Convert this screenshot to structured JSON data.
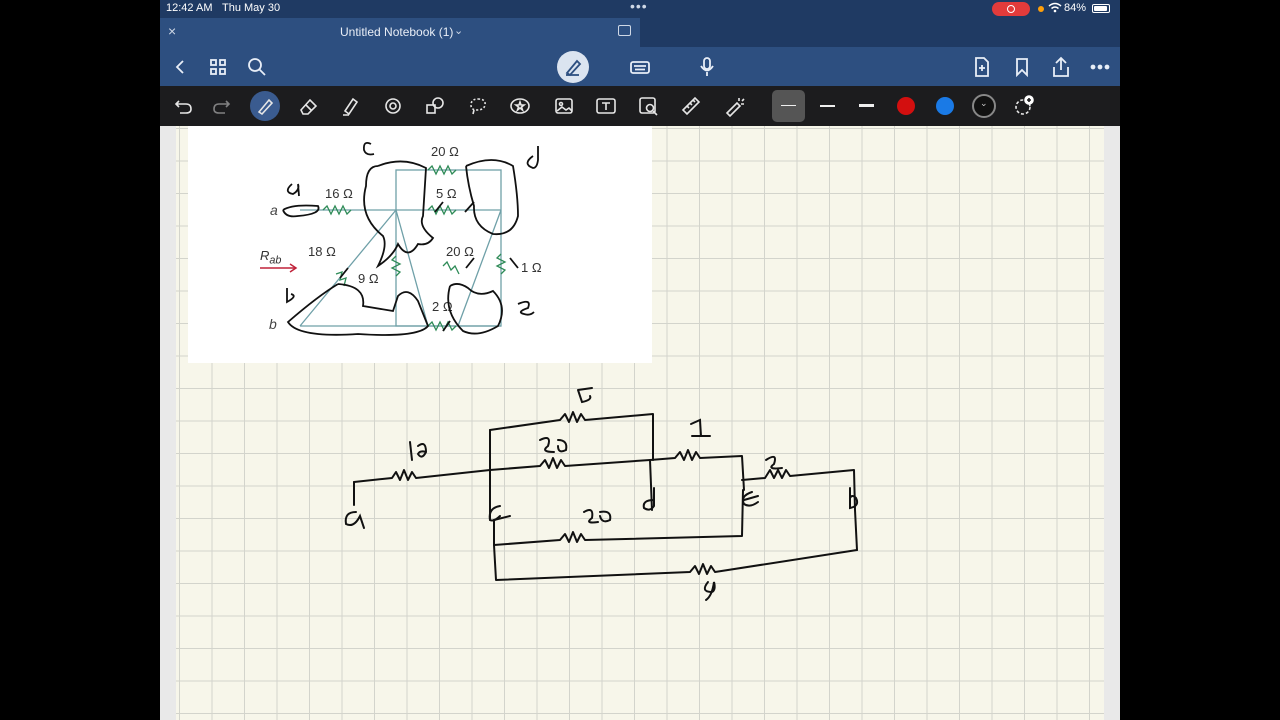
{
  "status": {
    "time": "12:42 AM",
    "date": "Thu May 30",
    "battery": "84%"
  },
  "tab": {
    "title": "Untitled Notebook (1)"
  },
  "toolbar": {
    "colors": [
      "#d30f0f",
      "#1a7ae6"
    ]
  },
  "figure": {
    "resistor_labels": [
      "20 Ω",
      "16 Ω",
      "5 Ω",
      "18 Ω",
      "20 Ω",
      "9 Ω",
      "1 Ω",
      "2 Ω"
    ],
    "nodes": [
      "a",
      "b"
    ],
    "rab_main": "R",
    "rab_sub": "ab",
    "handwritten_nodes": [
      "c",
      "d",
      "a",
      "b",
      "e"
    ]
  },
  "notes": {
    "values": [
      "5",
      "1",
      "16",
      "20",
      "2",
      "20",
      "9"
    ],
    "nodes": [
      "a",
      "c",
      "d",
      "e",
      "b"
    ]
  }
}
